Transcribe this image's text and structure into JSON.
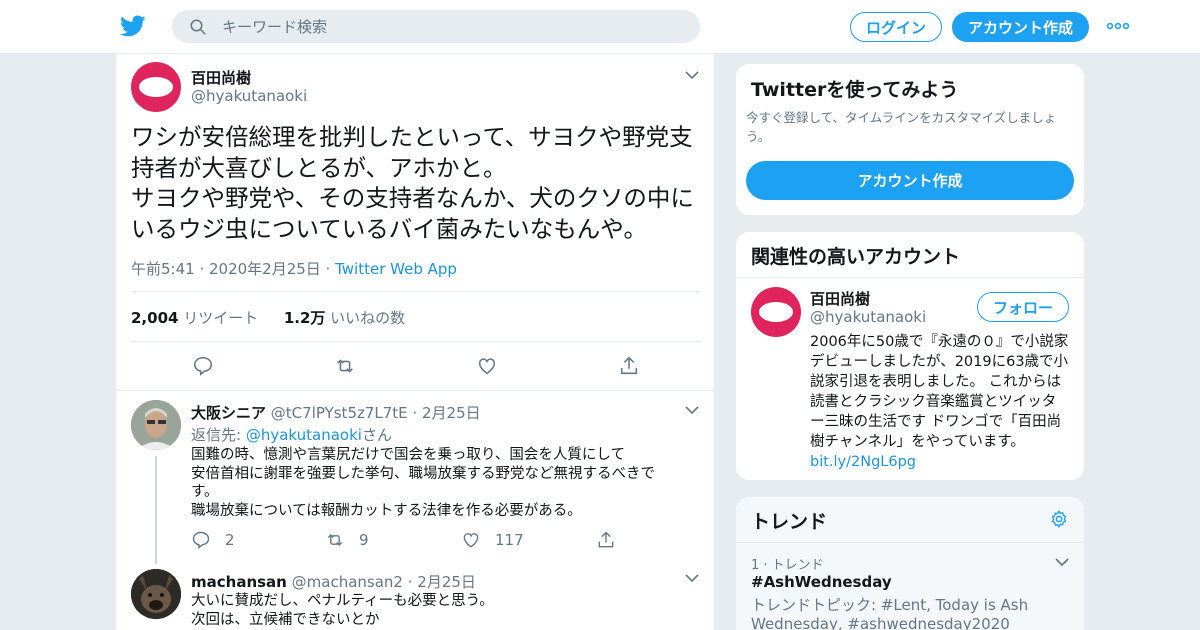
{
  "header": {
    "search_placeholder": "キーワード検索",
    "login_label": "ログイン",
    "signup_label": "アカウント作成",
    "brand_color": "#1da1f2"
  },
  "tweet": {
    "author_name": "百田尚樹",
    "author_handle": "@hyakutanaoki",
    "text_lines": [
      "ワシが安倍総理を批判したといって、サヨクや野党支",
      "持者が大喜びしとるが、アホかと。",
      "サヨクや野党や、その支持者なんか、犬のクソの中に",
      "いるウジ虫についているバイ菌みたいなもんや。"
    ],
    "time": "午前5:41 · 2020年2月25日 · ",
    "source": "Twitter Web App",
    "retweet_count": "2,004",
    "retweet_label": "リツイート",
    "like_count": "1.2万",
    "like_label": "いいねの数"
  },
  "replies": [
    {
      "name": "大阪シニア",
      "handle": "@tC7lPYst5z7L7tE",
      "date": "· 2月25日",
      "reply_to_prefix": "返信先: ",
      "reply_to_handle": "@hyakutanaoki",
      "reply_to_suffix": "さん",
      "lines": [
        "国難の時、憶測や言葉尻だけで国会を乗っ取り、国会を人質にして",
        "安倍首相に謝罪を強要した挙句、職場放棄する野党など無視するべきで",
        "す。",
        "職場放棄については報酬カットする法律を作る必要がある。"
      ],
      "reply_count": "2",
      "retweet_count": "9",
      "like_count": "117"
    },
    {
      "name": "machansan",
      "handle": "@machansan2",
      "date": "· 2月25日",
      "lines": [
        "大いに賛成だし、ペナルティーも必要と思う。",
        "次回は、立候補できないとか"
      ]
    }
  ],
  "sidebar": {
    "signup_card": {
      "title": "Twitterを使ってみよう",
      "subtitle": "今すぐ登録して、タイムラインをカスタマイズしましょう。",
      "button": "アカウント作成"
    },
    "related": {
      "title": "関連性の高いアカウント",
      "name": "百田尚樹",
      "handle": "@hyakutanaoki",
      "follow_label": "フォロー",
      "bio_lines": [
        "2006年に50歳で『永遠の０』で小説家",
        "デビューしましたが、2019に63歳で小",
        "説家引退を表明しました。 これからは",
        "読書とクラシック音楽鑑賞とツイッタ",
        "ー三昧の生活です ドワンゴで「百田尚",
        "樹チャンネル」をやっています。"
      ],
      "link": "bit.ly/2NgL6pg"
    },
    "trends": {
      "title": "トレンド",
      "item_rank": "1 · トレンド",
      "item_name": "#AshWednesday",
      "item_topics_1": "トレンドトピック: #Lent, Today is Ash",
      "item_topics_2": "Wednesday, #ashwednesday2020"
    }
  }
}
